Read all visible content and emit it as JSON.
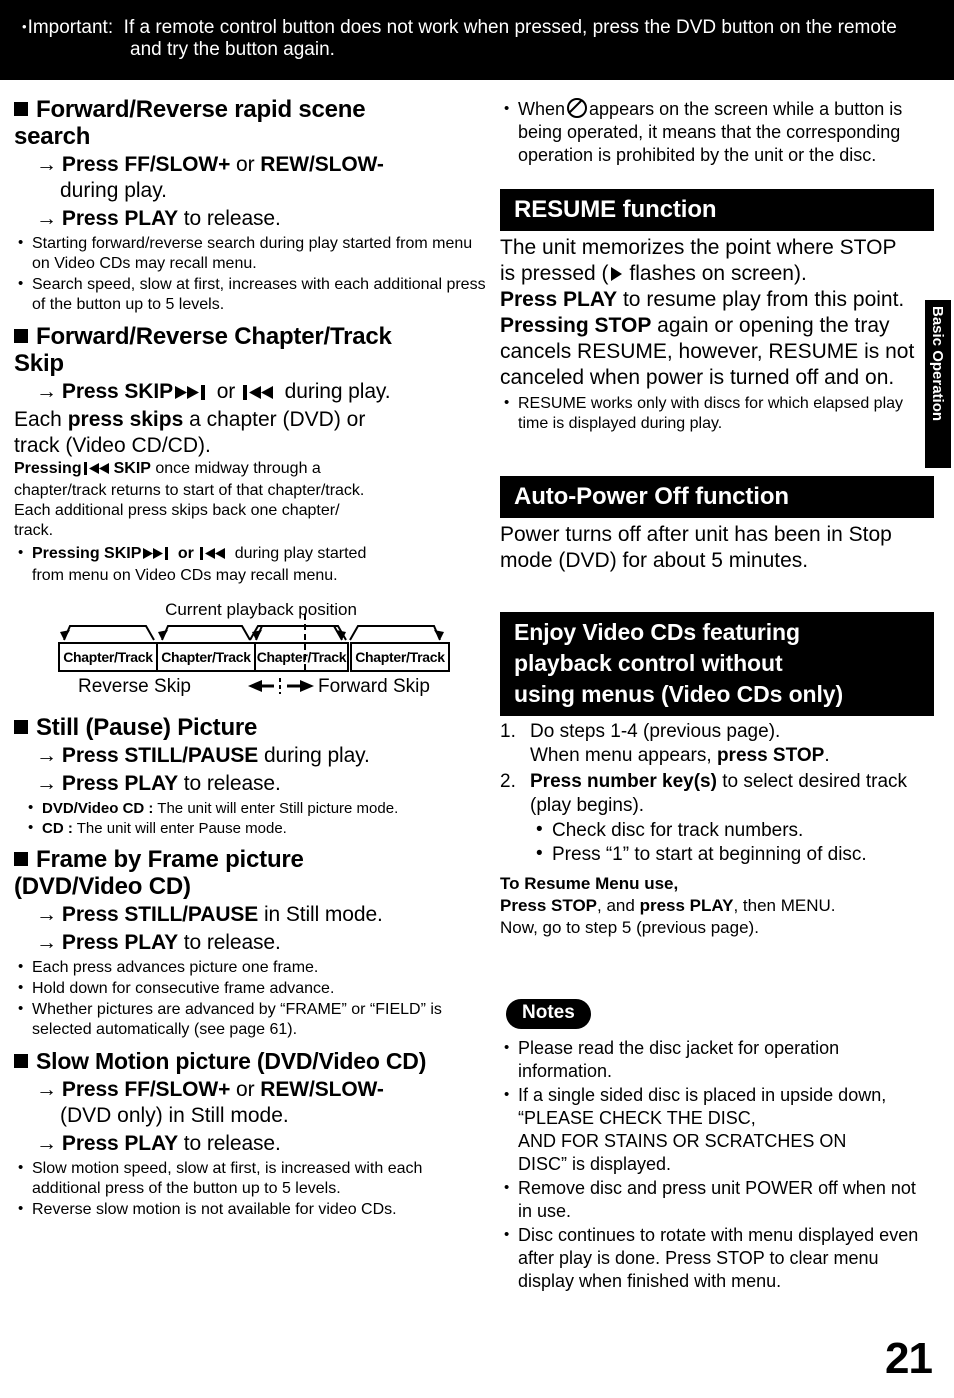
{
  "top_banner": {
    "bullet": "•",
    "label": "Important:",
    "text": "If a remote control button does not work when pressed, press the DVD button on the remote",
    "text_line2": "and try the button again."
  },
  "left_column": {
    "section_search": {
      "heading_line1": "Forward/Reverse rapid scene",
      "heading_line2": "search",
      "step1_pre": "Press FF/SLOW+",
      "step1_mid": " or ",
      "step1_post": "REW/SLOW-",
      "step1_cont": "during play.",
      "step2_pre": "Press PLAY",
      "step2_post": " to release.",
      "bullets": [
        "Starting forward/reverse search during play started from menu on Video CDs may recall menu.",
        "Search speed, slow at first, increases with each additional press of the button up to 5 levels."
      ]
    },
    "section_skip": {
      "heading_line1": "Forward/Reverse Chapter/Track",
      "heading_line2": "Skip",
      "step1_a": "Press SKIP",
      "step1_or": " or ",
      "step1_b": " during play.",
      "body_line1_a": "Each ",
      "body_line1_b": "press skips",
      "body_line1_c": " a chapter (DVD) or",
      "body_line2": "track (Video CD/CD).",
      "note_a": "Pressing",
      "note_b": "SKIP",
      "note_c": " once midway through a",
      "note_line2": "chapter/track returns to start of that chapter/track.",
      "note_line3": "Each additional press skips back one chapter/",
      "note_line4": "track.",
      "bullet_a": "Pressing SKIP",
      "bullet_or": " or ",
      "bullet_b": " during play started",
      "bullet_line2": "from menu on Video CDs may recall menu."
    },
    "diagram": {
      "caption": "Current playback position",
      "boxes": [
        "Chapter/Track",
        "Chapter/Track",
        "Chapter/Track",
        "Chapter/Track"
      ],
      "reverse_label": "Reverse Skip",
      "forward_label": "Forward Skip",
      "center_arrows": "←¦→"
    },
    "section_still": {
      "heading_line1": "Still (Pause) Picture",
      "step1_pre": "Press STILL/PAUSE",
      "step1_post": " during play.",
      "step2_pre": "Press PLAY",
      "step2_post": " to release.",
      "bullets": [
        {
          "bold": "DVD/Video CD :",
          "rest": " The unit will enter Still picture mode."
        },
        {
          "bold": "CD :",
          "rest": " The unit will enter Pause mode."
        }
      ]
    },
    "section_frame": {
      "heading_line1": "Frame by Frame picture",
      "heading_line2": "(DVD/Video CD)",
      "step1_pre": "Press STILL/PAUSE",
      "step1_post": " in Still mode.",
      "step2_pre": "Press PLAY",
      "step2_post": " to release.",
      "bullets": [
        "Each press advances picture one frame.",
        "Hold down for consecutive frame advance.",
        "Whether pictures are advanced by “FRAME” or “FIELD” is selected automatically (see page 61)."
      ]
    },
    "section_slow": {
      "heading_line1": "Slow Motion picture (DVD/Video CD)",
      "step1_pre": "Press FF/SLOW+",
      "step1_mid": " or ",
      "step1_post": "REW/SLOW-",
      "step1_cont": "(DVD only) in Still mode.",
      "step2_pre": "Press PLAY",
      "step2_post": " to release.",
      "bullets": [
        "Slow motion speed, slow at first, is increased with each additional press of the button up to 5 levels.",
        "Reverse slow motion is not available for video CDs."
      ]
    }
  },
  "right_column": {
    "prohibit_note": {
      "part1": "When",
      "part2": "appears on the screen while a button is being operated, it means that the corresponding operation is prohibited by the unit or the disc."
    },
    "section_resume": {
      "title": "RESUME function",
      "line1_a": "The unit memorizes the point where STOP",
      "line1_b": "is pressed (",
      "line1_c": " flashes on screen).",
      "line2_bold": "Press PLAY",
      "line2_rest": " to resume play from this point.",
      "line3_bold": "Pressing STOP",
      "line3_rest": " again or opening the tray cancels RESUME, however, RESUME is not canceled when power is turned off and on.",
      "bullets": [
        "RESUME works only with discs for which elapsed play time is displayed during play."
      ]
    },
    "section_autopower": {
      "title": "Auto-Power Off function",
      "body": "Power turns off after unit has been in Stop mode (DVD) for about 5 minutes."
    },
    "section_enjoy": {
      "title_line1": "Enjoy Video CDs featuring",
      "title_line2": "playback control without",
      "title_line3": "using menus (Video CDs only)",
      "steps": [
        {
          "num": "1.",
          "text_a": "Do steps 1-4 (previous page).",
          "text_b": "When menu appears, ",
          "bold_b": "press STOP",
          "text_c": "."
        },
        {
          "num": "2.",
          "bold_a": "Press number key(s)",
          "text_a": " to select desired track (play begins).",
          "sub": [
            "Check disc for track numbers.",
            "Press “1” to start at beginning of disc."
          ]
        }
      ],
      "resume_menu": {
        "line1": "To Resume Menu use,",
        "line2_a": "Press STOP",
        "line2_b": ", and ",
        "line2_c": "press PLAY",
        "line2_d": ", then MENU.",
        "line3": "Now, go to step 5 (previous page)."
      }
    },
    "notes": {
      "badge": "Notes",
      "items": [
        "Please read the disc jacket for operation information.",
        "If a single sided disc is placed in upside down, “PLEASE CHECK THE DISC,\nAND FOR STAINS OR SCRATCHES ON\nDISC” is displayed.",
        "Remove disc and press unit POWER off when not in use.",
        "Disc continues to rotate with menu displayed even after play is done. Press STOP to clear menu display when finished with menu."
      ]
    }
  },
  "side_tab": {
    "label": "Basic Operation"
  },
  "page_number": "21"
}
